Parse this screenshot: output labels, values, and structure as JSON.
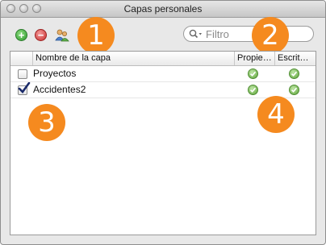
{
  "window": {
    "title": "Capas personales"
  },
  "toolbar": {
    "add_icon": "plus-icon",
    "remove_icon": "minus-icon",
    "users_icon": "users-icon"
  },
  "search": {
    "placeholder": "Filtro",
    "value": ""
  },
  "badges": {
    "one": "1",
    "two": "2",
    "three": "3",
    "four": "4"
  },
  "table": {
    "columns": [
      "Nombre de la capa",
      "Propie…",
      "Escrit…"
    ],
    "rows": [
      {
        "name": "Proyectos",
        "checked": false,
        "propietario": true,
        "escritura": true
      },
      {
        "name": "Accidentes2",
        "checked": true,
        "propietario": true,
        "escritura": true
      }
    ]
  },
  "colors": {
    "badge": "#f58a1f",
    "add": "#3aa53a",
    "remove": "#d23b3b",
    "ok": "#5ea53a"
  }
}
